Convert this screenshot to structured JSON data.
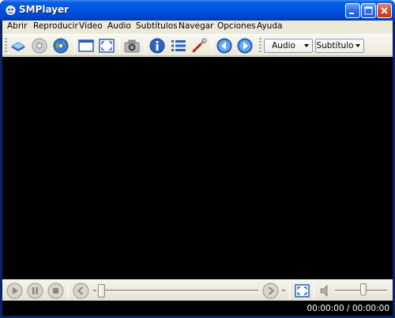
{
  "window": {
    "title": "SMPlayer"
  },
  "menubar": {
    "items": [
      {
        "label": "Abrir"
      },
      {
        "label": "Reproducir"
      },
      {
        "label": "Vídeo"
      },
      {
        "label": "Audio"
      },
      {
        "label": "Subtítulos"
      },
      {
        "label": "Navegar"
      },
      {
        "label": "Opciones"
      },
      {
        "label": "Ayuda"
      }
    ]
  },
  "toolbar": {
    "tools": [
      {
        "icon": "open-file-icon"
      },
      {
        "icon": "open-dvd-icon"
      },
      {
        "icon": "open-url-icon"
      },
      {
        "icon": "compact-view-icon"
      },
      {
        "icon": "fullscreen-icon"
      },
      {
        "icon": "screenshot-icon"
      },
      {
        "icon": "info-icon"
      },
      {
        "icon": "playlist-icon"
      },
      {
        "icon": "preferences-icon"
      },
      {
        "icon": "previous-icon"
      },
      {
        "icon": "next-icon"
      }
    ],
    "audio_label": "Audio",
    "subtitle_label": "Subtítulo"
  },
  "controls": {
    "seek_position": 0,
    "volume_level": 0.55
  },
  "status": {
    "time": "00:00:00 / 00:00:00"
  },
  "colors": {
    "titlebar": "#0054e3",
    "video_background": "#000000",
    "chrome": "#ece9d8",
    "close_button": "#d9482a"
  }
}
